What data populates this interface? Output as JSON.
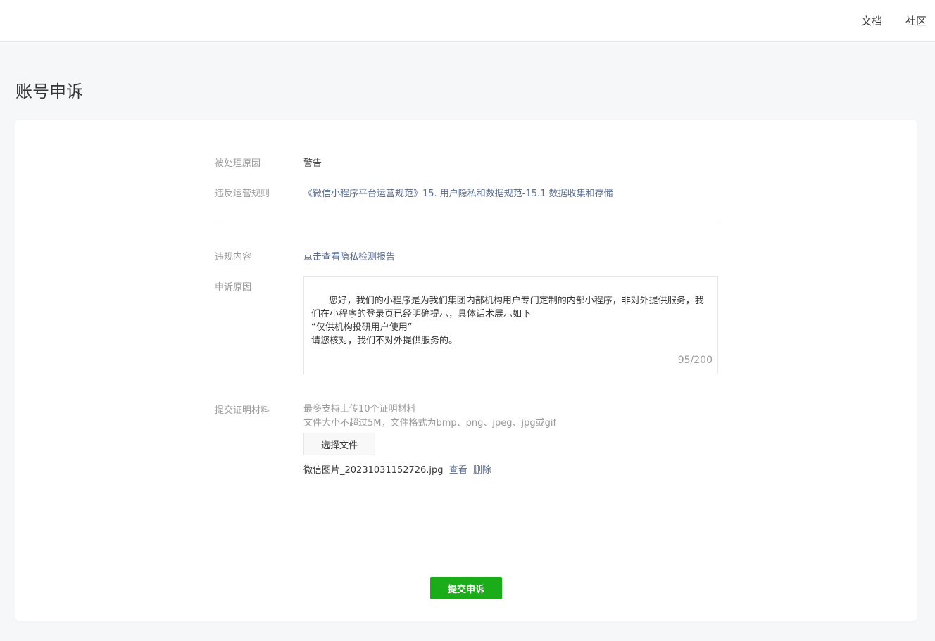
{
  "header": {
    "nav": [
      {
        "label": "文档"
      },
      {
        "label": "社区"
      }
    ]
  },
  "page": {
    "title": "账号申诉"
  },
  "form": {
    "reason": {
      "label": "被处理原因",
      "value": "警告"
    },
    "rule": {
      "label": "违反运营规则",
      "value": "《微信小程序平台运营规范》15. 用户隐私和数据规范-15.1 数据收集和存储"
    },
    "content": {
      "label": "违规内容",
      "value": "点击查看隐私检测报告"
    },
    "appeal": {
      "label": "申诉原因",
      "text": "您好，我们的小程序是为我们集团内部机构用户专门定制的内部小程序，非对外提供服务，我们在小程序的登录页已经明确提示，具体话术展示如下\n“仅供机构投研用户使用”\n请您核对，我们不对外提供服务的。",
      "counter": "95/200"
    },
    "materials": {
      "label": "提交证明材料",
      "hint1": "最多支持上传10个证明材料",
      "hint2": "文件大小不超过5M，文件格式为bmp、png、jpeg、jpg或gif",
      "button": "选择文件",
      "file_name": "微信图片_20231031152726.jpg",
      "view": "查看",
      "delete": "删除"
    },
    "submit": "提交申诉"
  }
}
